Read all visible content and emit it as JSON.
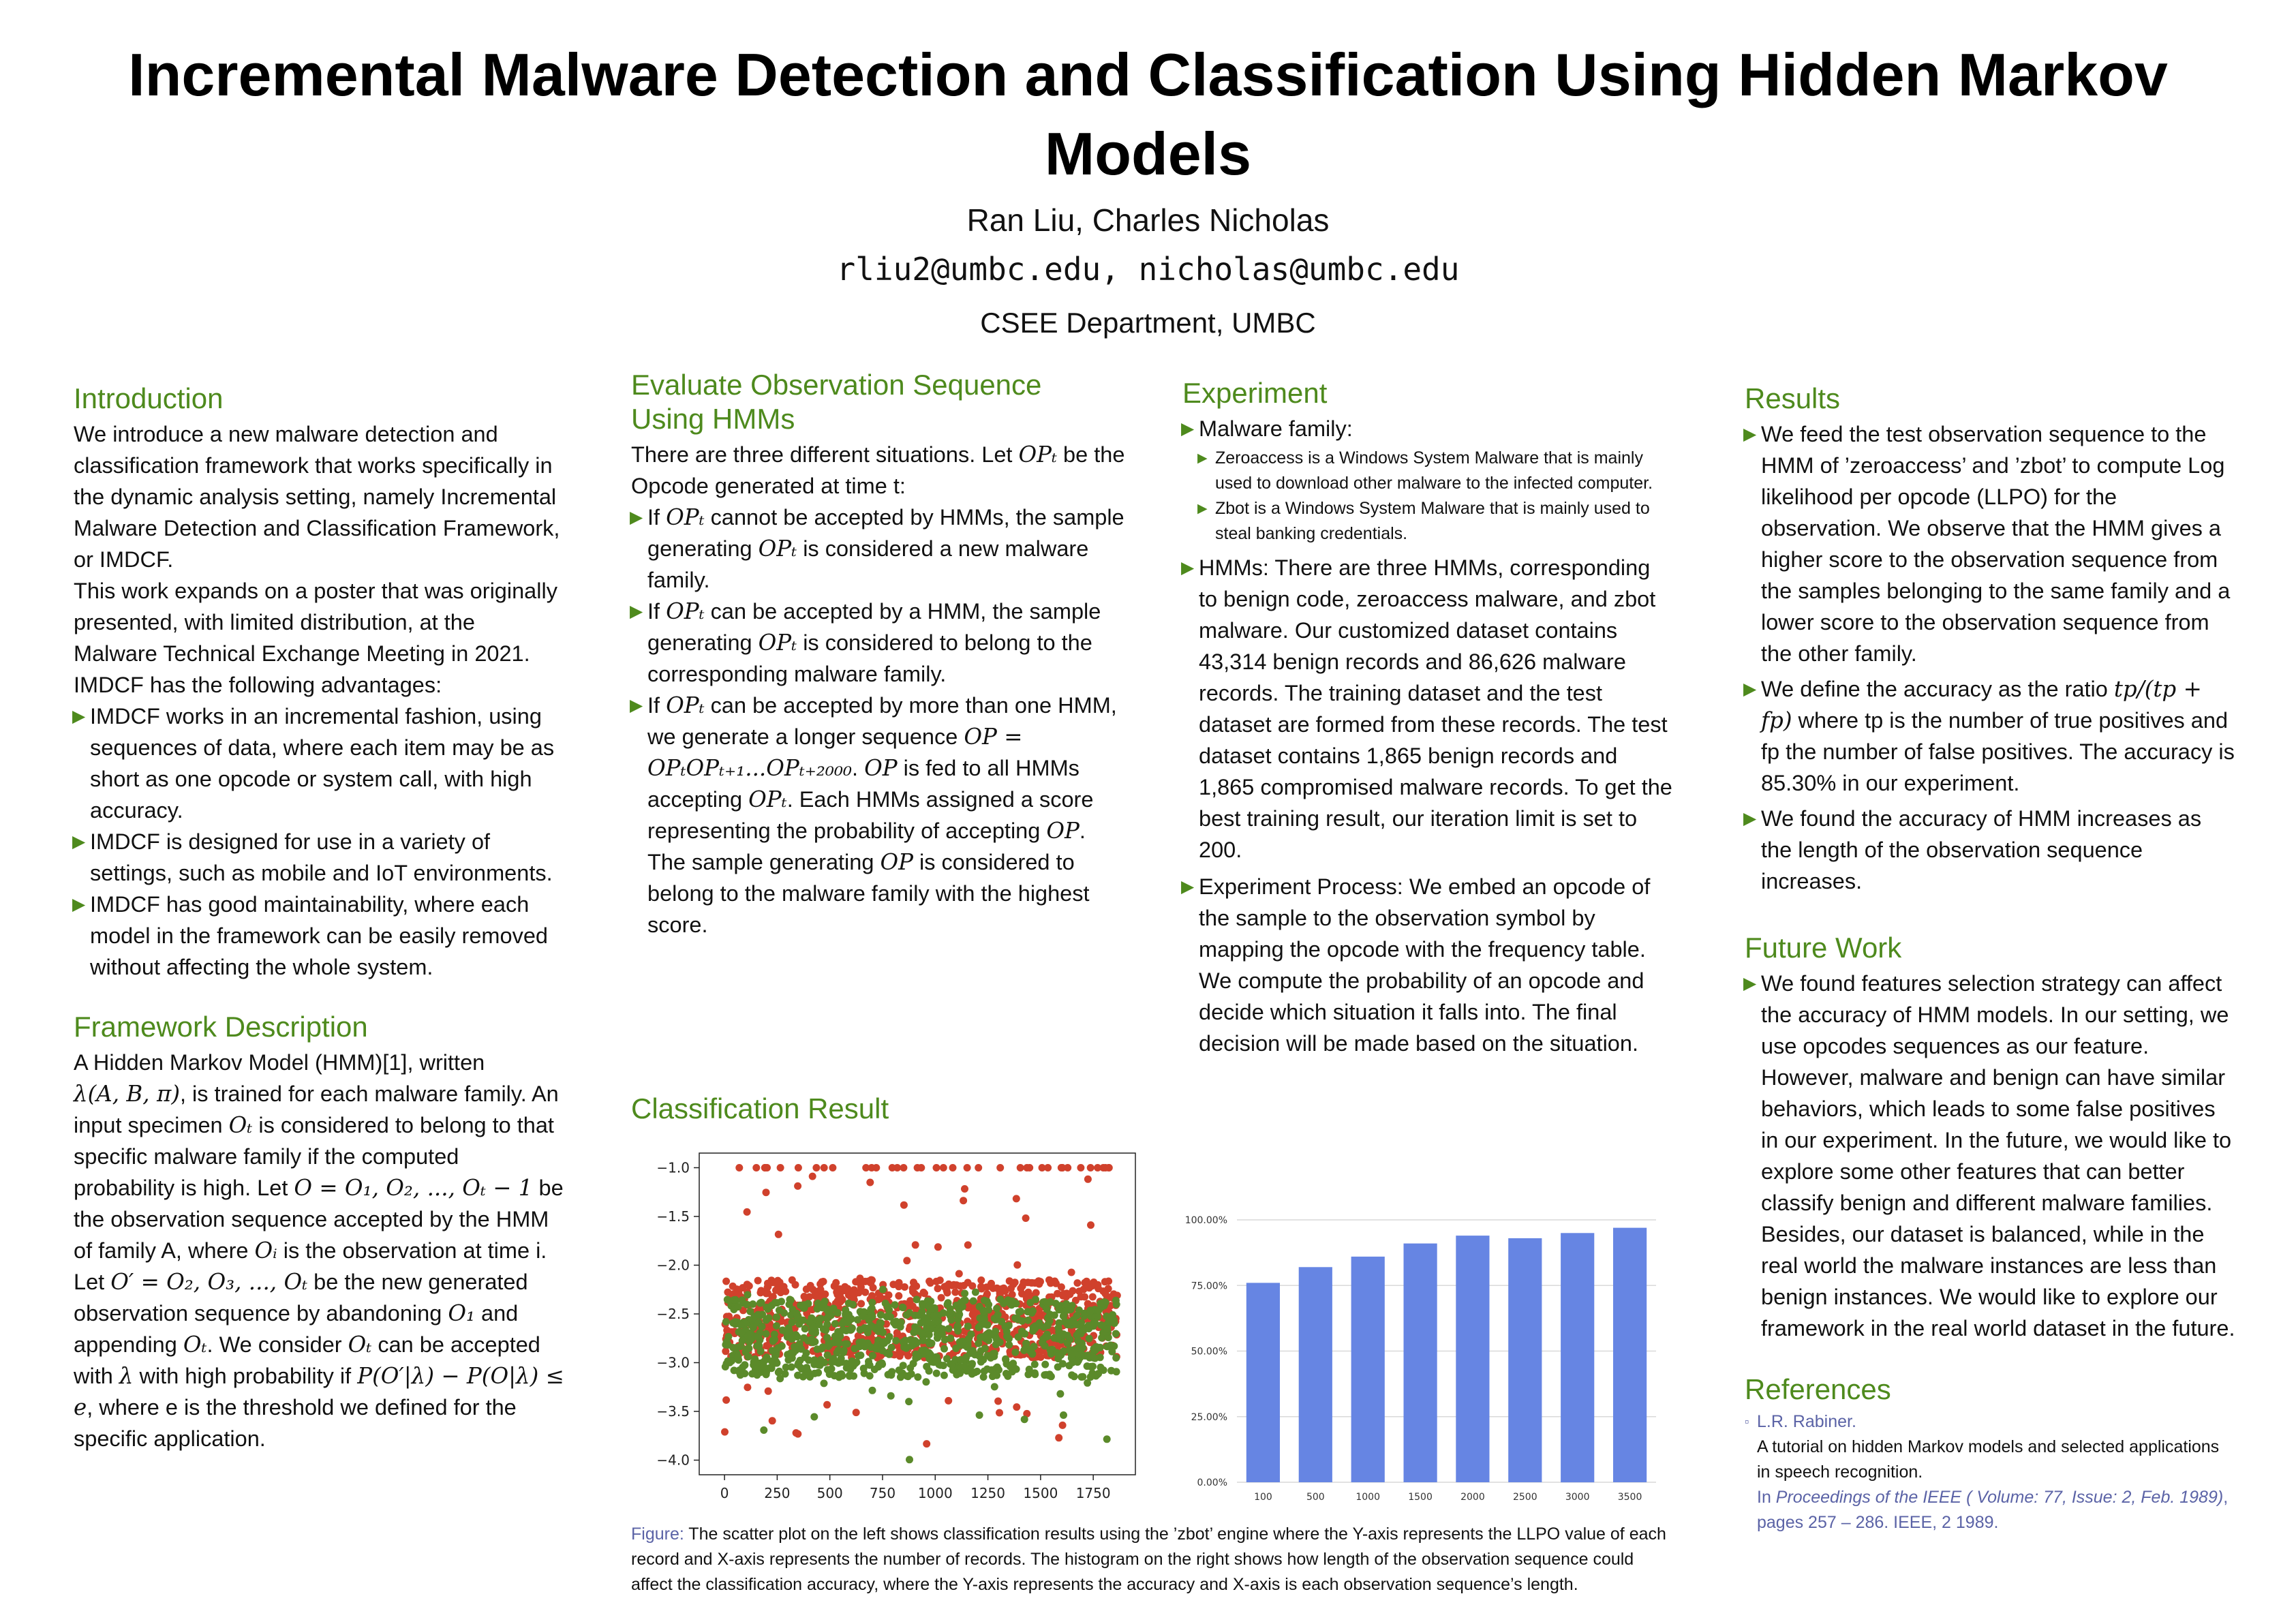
{
  "header": {
    "title": "Incremental Malware Detection and Classification Using Hidden Markov Models",
    "authors": "Ran Liu, Charles Nicholas",
    "emails": "rliu2@umbc.edu, nicholas@umbc.edu",
    "department": "CSEE Department, UMBC"
  },
  "intro": {
    "title": "Introduction",
    "p1": "We introduce a new malware detection and classification framework that works specifically in the dynamic analysis setting, namely Incremental Malware Detection and Classification Framework, or IMDCF.",
    "p2": "This work expands on a poster that was originally presented, with limited distribution, at the Malware Technical Exchange Meeting in 2021.",
    "p3": "IMDCF has the following advantages:",
    "bullets": [
      "IMDCF works in an incremental fashion, using sequences of data, where each item may be as short as one opcode or system call, with high accuracy.",
      "IMDCF is designed for use in a variety of settings, such as mobile and IoT environments.",
      "IMDCF has good maintainability, where each model in the framework can be easily removed without affecting the whole system."
    ]
  },
  "framework": {
    "title": "Framework Description",
    "t1": "A Hidden Markov Model (HMM)[1], written",
    "m1": "λ(A, B, π)",
    "t2": ", is trained for each malware family. An input specimen ",
    "m2": "Oₜ",
    "t3": " is considered to belong to that specific malware family if the computed probability is high. Let ",
    "m3": "O = O₁, O₂, ..., Oₜ − 1",
    "t4": " be the observation sequence accepted by the HMM of family A, where ",
    "m4": "Oᵢ",
    "t5": " is the observation at time i. Let ",
    "m5": "O′ = O₂, O₃, ..., Oₜ",
    "t6": " be the new generated observation sequence by abandoning ",
    "m6": "O₁",
    "t7": " and appending ",
    "m7": "Oₜ",
    "t8": ". We consider ",
    "m8": "Oₜ",
    "t9": " can be accepted with ",
    "m9": "λ",
    "t10": " with high probability if ",
    "m10": "P(O′|λ) − P(O|λ) ≤ e",
    "t11": ", where e is the threshold we defined for the specific application."
  },
  "evaluate": {
    "title": "Evaluate Observation Sequence Using HMMs",
    "p1a": "There are three different situations. Let ",
    "p1m": "OPₜ",
    "p1b": " be the Opcode generated at time t:",
    "b1a": "If ",
    "b1m1": "OPₜ",
    "b1b": " cannot be accepted by HMMs, the sample generating ",
    "b1m2": "OPₜ",
    "b1c": " is considered a new malware family.",
    "b2a": "If ",
    "b2m1": "OPₜ",
    "b2b": " can be accepted by a HMM, the sample generating ",
    "b2m2": "OPₜ",
    "b2c": " is considered to belong to the corresponding malware family.",
    "b3a": "If ",
    "b3m1": "OPₜ",
    "b3b": " can be accepted by more than one HMM, we generate a longer sequence ",
    "b3m2": "OP = OPₜOPₜ₊₁...OPₜ₊₂₀₀₀",
    "b3c": ". ",
    "b3m3": "OP",
    "b3d": " is fed to all HMMs accepting ",
    "b3m4": "OPₜ",
    "b3e": ". Each HMMs assigned a score representing the probability of accepting ",
    "b3m5": "OP",
    "b3f": ". The sample generating ",
    "b3m6": "OP",
    "b3g": " is considered to belong to the malware family with the highest score."
  },
  "experiment": {
    "title": "Experiment",
    "b1": "Malware family:",
    "sub": [
      "Zeroaccess is a Windows System Malware that is mainly used to download other malware to the infected computer.",
      "Zbot is a Windows System Malware that is mainly used to steal banking credentials."
    ],
    "b2": "HMMs: There are three HMMs, corresponding to benign code, zeroaccess malware, and zbot malware. Our customized dataset contains 43,314 benign records and 86,626 malware records. The training dataset and the test dataset are formed from these records. The test dataset contains 1,865 benign records and 1,865 compromised malware records. To get the best training result, our iteration limit is set to 200.",
    "b3": "Experiment Process: We embed an opcode of the sample to the observation symbol by mapping the opcode with the frequency table. We compute the probability of an opcode and decide which situation it falls into. The final decision will be made based on the situation."
  },
  "results": {
    "title": "Results",
    "b1": "We feed the test observation sequence to the HMM of ’zeroaccess’ and ’zbot’ to compute Log likelihood per opcode (LLPO) for the observation. We observe that the HMM gives a higher score to the observation sequence from the samples belonging to the same family and a lower score to the observation sequence from the other family.",
    "b2a": "We define the accuracy as the ratio ",
    "b2m": "tp/(tp + fp)",
    "b2b": " where tp is the number of true positives and fp the number of false positives. The accuracy is 85.30% in our experiment.",
    "b3": "We found the accuracy of HMM increases as the length of the observation sequence increases."
  },
  "future": {
    "title": "Future Work",
    "b1": "We found features selection strategy can affect the accuracy of HMM models. In our setting, we use opcodes sequences as our feature. However, malware and benign can have similar behaviors, which leads to some false positives in our experiment. In the future, we would like to explore some other features that can better classify benign and different malware families. Besides, our dataset is balanced, while in the real world the malware instances are less than benign instances. We would like to explore our framework in the real world dataset in the future."
  },
  "references": {
    "title": "References",
    "marker": "▫",
    "author": "L.R. Rabiner.",
    "work": "A tutorial on hidden Markov models and selected applications in speech recognition.",
    "in_prefix": "In ",
    "journal": "Proceedings of the IEEE ( Volume: 77, Issue: 2, Feb. 1989)",
    "pages": ", pages 257 – 286. IEEE, 2 1989."
  },
  "classification": {
    "title": "Classification Result",
    "caption_label": "Figure:",
    "caption_text": " The scatter plot on the left shows classification results using the ’zbot’ engine where the Y-axis represents the LLPO value of each record and X-axis represents the number of records. The histogram on the right shows how length of the observation sequence could affect the classification accuracy, where the Y-axis represents the accuracy and X-axis is each observation sequence’s length."
  },
  "chart_data": [
    {
      "type": "scatter",
      "title": "",
      "xlabel": "",
      "ylabel": "",
      "xlim": [
        -120,
        1950
      ],
      "ylim": [
        -4.15,
        -0.85
      ],
      "xticks": [
        0,
        250,
        500,
        750,
        1000,
        1250,
        1500,
        1750
      ],
      "xtick_labels": [
        "0",
        "250",
        "500",
        "750",
        "1000",
        "1250",
        "1500",
        "1750"
      ],
      "yticks": [
        -1.0,
        -1.5,
        -2.0,
        -2.5,
        -3.0,
        -3.5,
        -4.0
      ],
      "ytick_labels": [
        "−1.0",
        "−1.5",
        "−2.0",
        "−2.5",
        "−3.0",
        "−3.5",
        "−4.0"
      ],
      "grid": false,
      "series": [
        {
          "color": "#d0412c",
          "n_points": 1865,
          "x_range": [
            0,
            1865
          ],
          "core_y_range": [
            -2.95,
            -2.15
          ],
          "outlier_y_range": [
            -3.9,
            -1.0
          ]
        },
        {
          "color": "#5b8a2a",
          "n_points": 1865,
          "x_range": [
            0,
            1865
          ],
          "core_y_range": [
            -3.15,
            -2.35
          ],
          "outlier_y_range": [
            -4.0,
            -2.2
          ]
        }
      ]
    },
    {
      "type": "bar",
      "title": "",
      "xlabel": "",
      "ylabel": "",
      "categories": [
        "100",
        "500",
        "1000",
        "1500",
        "2000",
        "2500",
        "3000",
        "3500"
      ],
      "values": [
        0.76,
        0.82,
        0.86,
        0.91,
        0.94,
        0.93,
        0.95,
        0.97
      ],
      "ylim": [
        0,
        1.0
      ],
      "yticks": [
        0,
        0.25,
        0.5,
        0.75,
        1.0
      ],
      "ytick_labels": [
        "0.00%",
        "25.00%",
        "50.00%",
        "75.00%",
        "100.00%"
      ],
      "grid": true,
      "bar_color": "#6685e3"
    }
  ]
}
